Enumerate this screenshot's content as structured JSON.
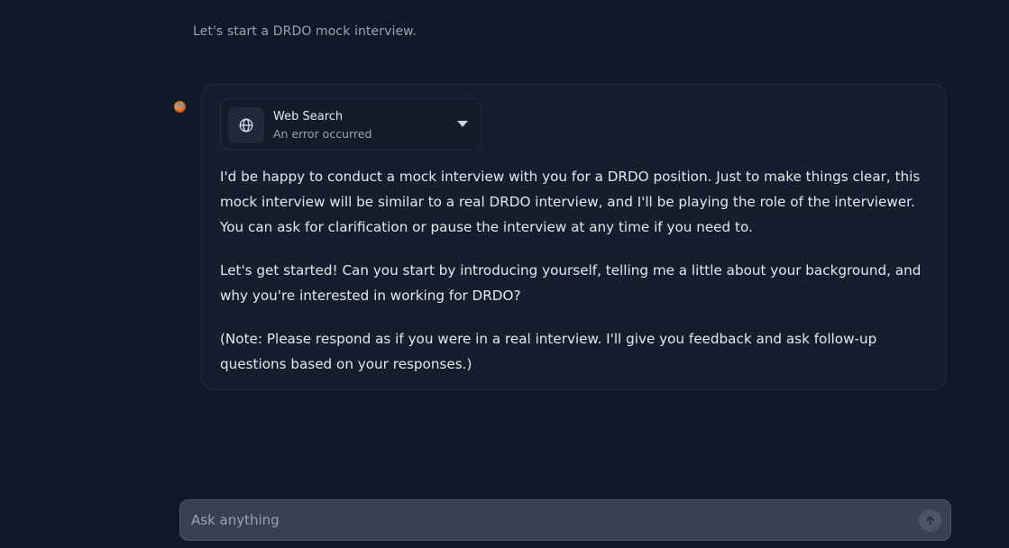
{
  "conversation": {
    "user_message": "Let's start a DRDO mock interview.",
    "assistant": {
      "tool": {
        "title": "Web Search",
        "status": "An error occurred",
        "icon": "globe-icon"
      },
      "paragraphs": [
        "I'd be happy to conduct a mock interview with you for a DRDO position. Just to make things clear, this mock interview will be similar to a real DRDO interview, and I'll be playing the role of the interviewer. You can ask for clarification or pause the interview at any time if you need to.",
        "Let's get started! Can you start by introducing yourself, telling me a little about your background, and why you're interested in working for DRDO?",
        "(Note: Please respond as if you were in a real interview. I'll give you feedback and ask follow-up questions based on your responses.)"
      ]
    }
  },
  "composer": {
    "placeholder": "Ask anything",
    "send_icon": "arrow-up-icon"
  },
  "colors": {
    "background": "#121827",
    "card": "#161e2d",
    "composer": "#374151"
  }
}
